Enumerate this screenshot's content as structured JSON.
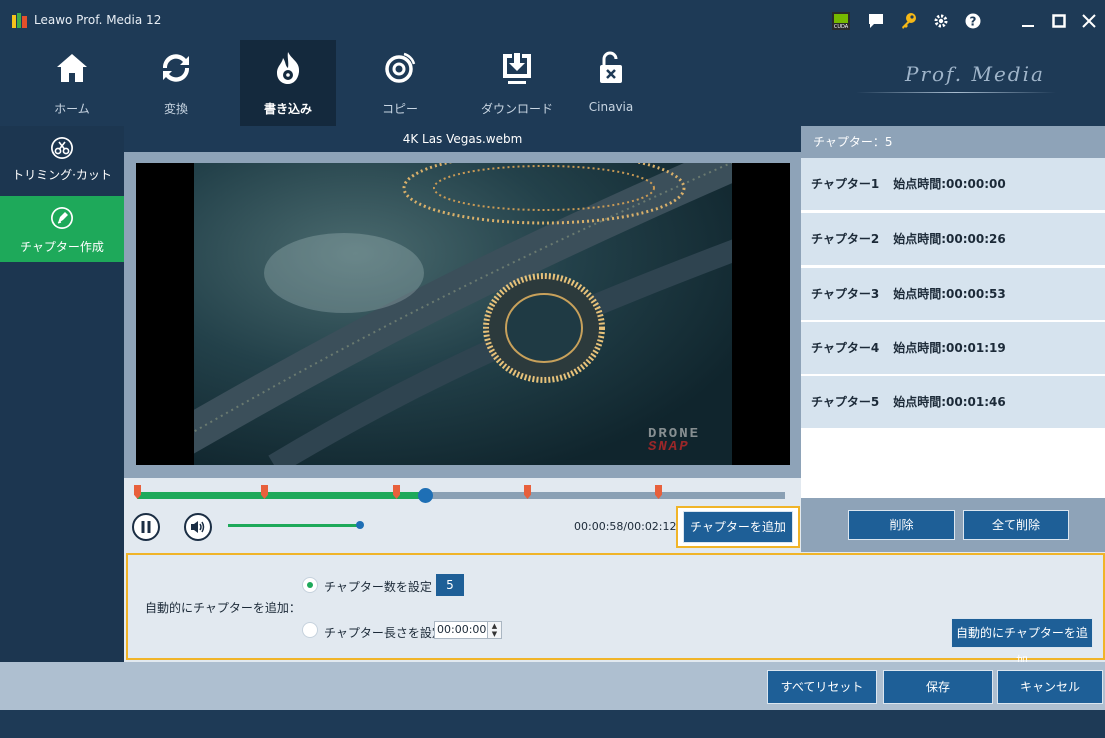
{
  "app": {
    "title": "Leawo Prof. Media 12"
  },
  "titlebar": {
    "icons": [
      "cuda-icon",
      "feedback-icon",
      "key-icon",
      "settings-icon",
      "help-icon",
      "minimize-icon",
      "maximize-icon",
      "close-icon"
    ]
  },
  "toolbar": {
    "items": [
      {
        "label": "ホーム",
        "icon": "home-icon"
      },
      {
        "label": "変換",
        "icon": "convert-icon"
      },
      {
        "label": "書き込み",
        "icon": "burn-icon",
        "active": true
      },
      {
        "label": "コピー",
        "icon": "copy-disc-icon"
      },
      {
        "label": "ダウンロード",
        "icon": "download-icon"
      },
      {
        "label": "Cinavia",
        "icon": "unlock-icon"
      }
    ],
    "brand": "Prof. Media"
  },
  "sidebar": {
    "items": [
      {
        "label": "トリミング·カット",
        "icon": "scissors-icon"
      },
      {
        "label": "チャプター作成",
        "icon": "chapter-icon",
        "active": true
      }
    ]
  },
  "video": {
    "filename": "4K Las Vegas.webm",
    "watermark_line1": "DRONE",
    "watermark_line2": "SNAP",
    "time_display": "00:00:58/00:02:12",
    "progress": 0.44,
    "volume": 1.0,
    "add_chapter_label": "チャプターを追加"
  },
  "chapters": {
    "header": "チャプター：5",
    "items": [
      {
        "name": "チャプター1",
        "start": "始点時間:00:00:00"
      },
      {
        "name": "チャプター2",
        "start": "始点時間:00:00:26"
      },
      {
        "name": "チャプター3",
        "start": "始点時間:00:00:53"
      },
      {
        "name": "チャプター4",
        "start": "始点時間:00:01:19"
      },
      {
        "name": "チャプター5",
        "start": "始点時間:00:01:46"
      }
    ],
    "delete_label": "削除",
    "delete_all_label": "全て削除"
  },
  "auto": {
    "label": "自動的にチャプターを追加：",
    "option_count_label": "チャプター数を設定",
    "count_value": "5",
    "option_length_label": "チャプター長さを設定",
    "length_value": "00:00:00",
    "add_button_label": "自動的にチャプターを追加"
  },
  "footer": {
    "reset_label": "すべてリセット",
    "save_label": "保存",
    "cancel_label": "キャンセル"
  },
  "colors": {
    "accent_green": "#1ea95a",
    "primary_blue": "#1e5f97",
    "highlight": "#f0b428",
    "titlebar": "#1e3a56"
  }
}
